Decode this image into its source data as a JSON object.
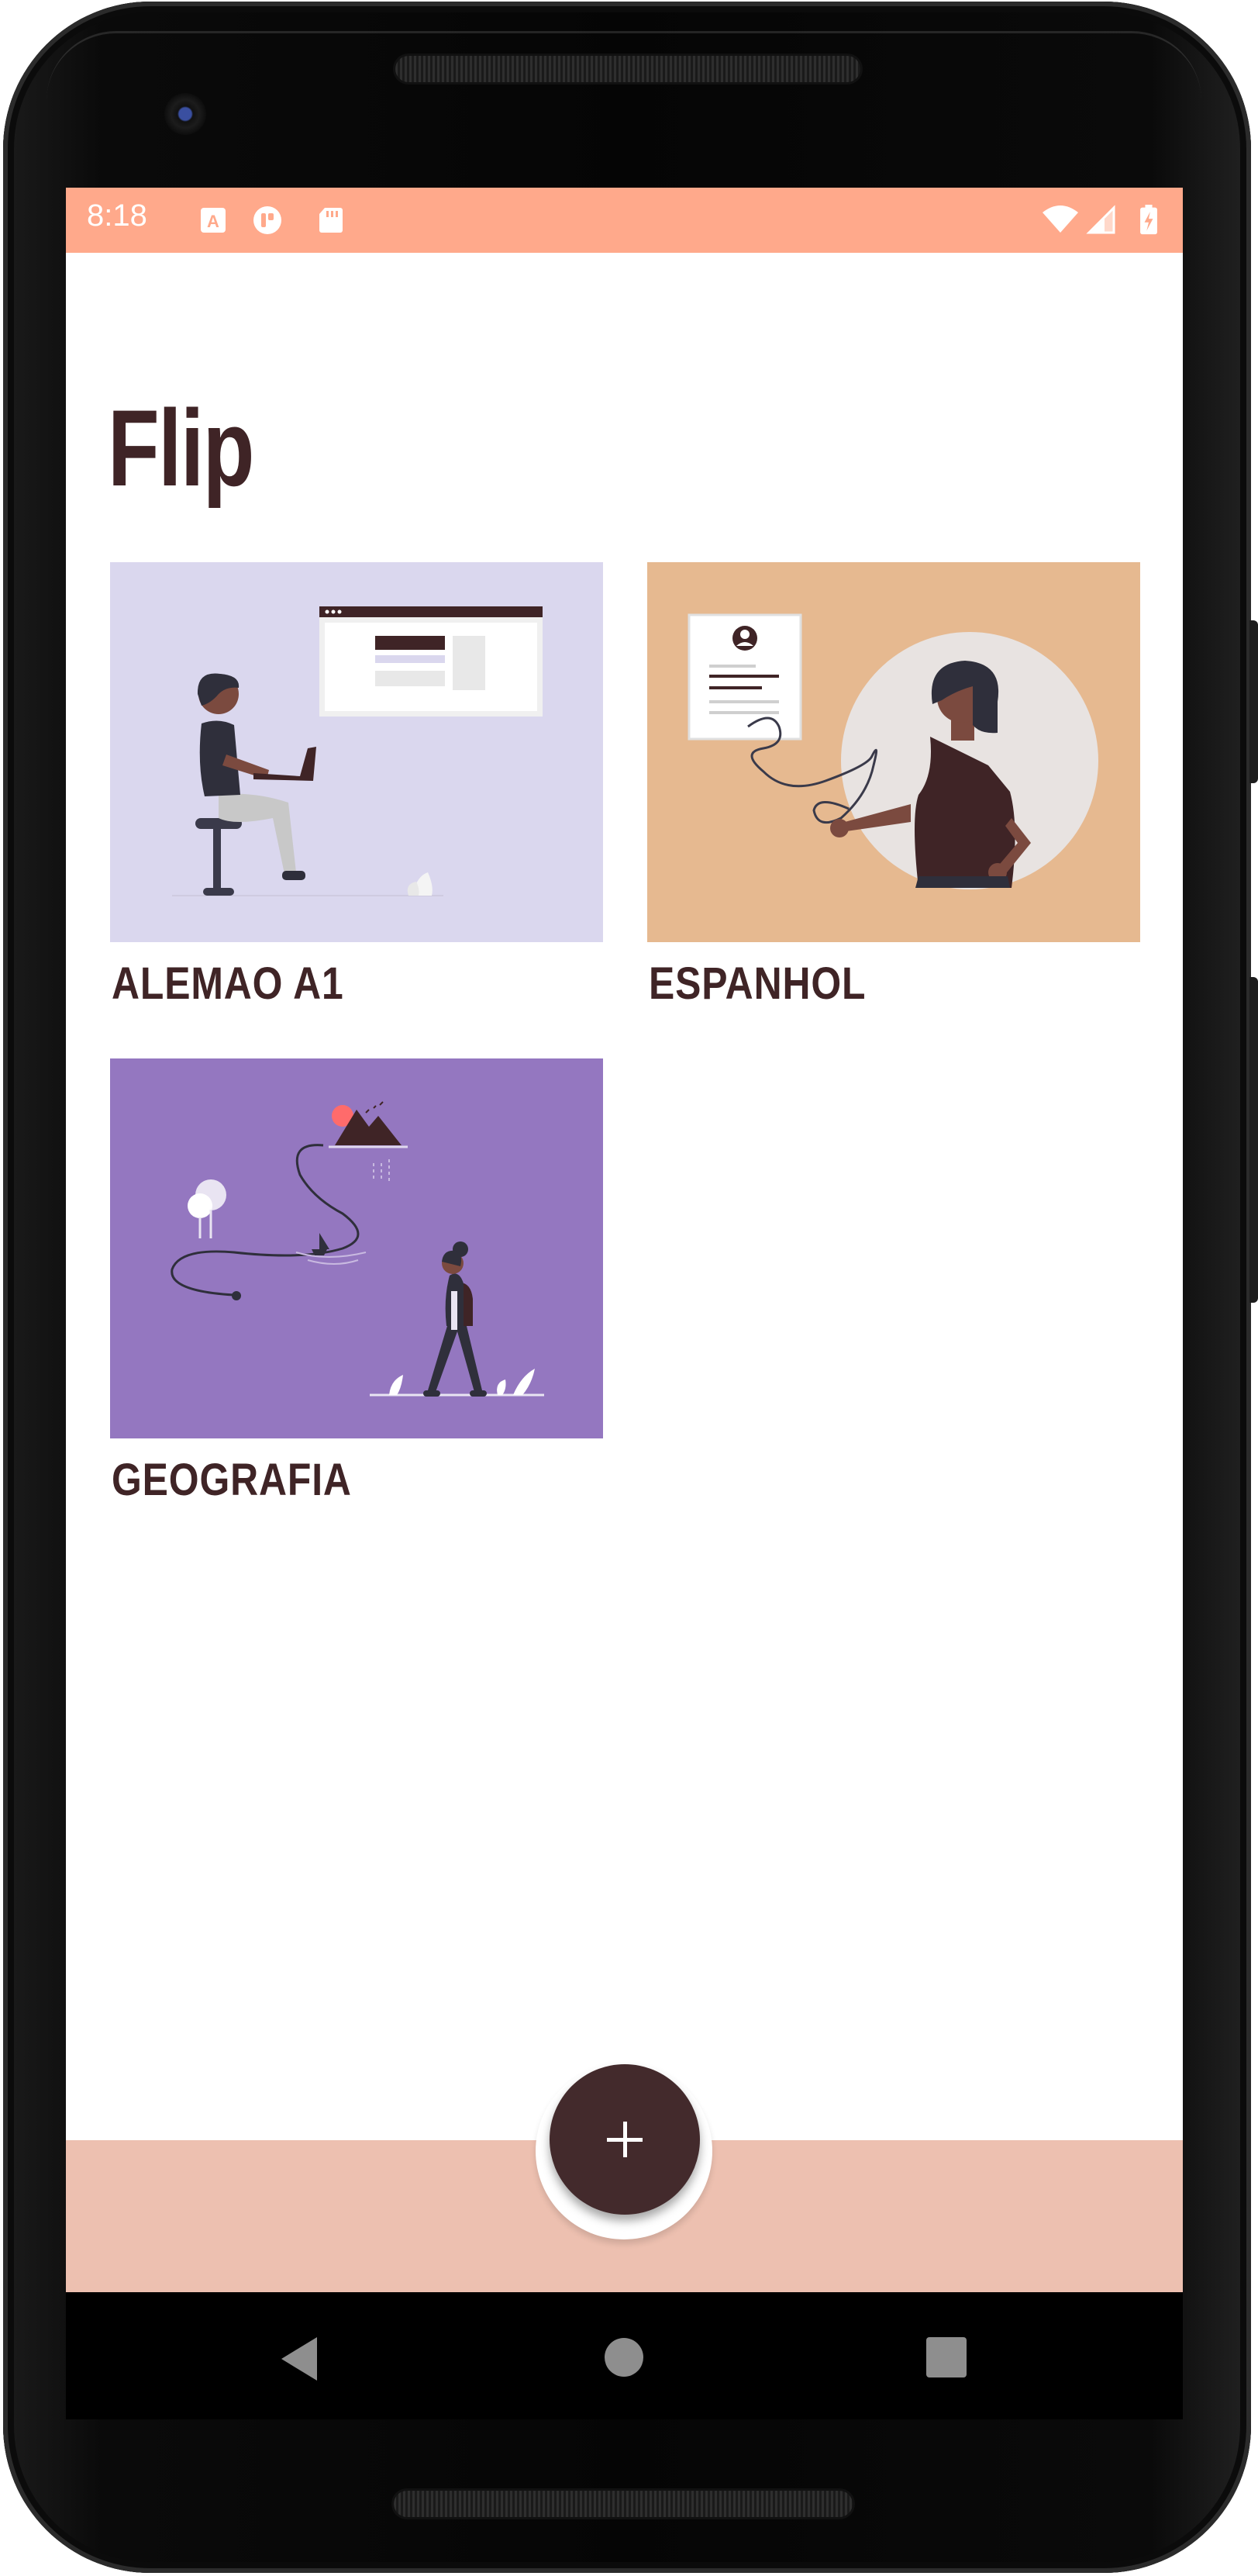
{
  "status_bar": {
    "time": "8:18",
    "background": "#ffa98b",
    "icons": [
      "translate-icon",
      "app-circle-icon",
      "sd-card-icon",
      "wifi-icon",
      "signal-icon",
      "battery-charging-icon"
    ]
  },
  "app": {
    "title": "Flip",
    "text_color": "#3f2426"
  },
  "decks": [
    {
      "label": "Alemao A1",
      "image": "person-laptop-illustration",
      "background": "#dad7ee"
    },
    {
      "label": "Espanhol",
      "image": "person-profile-card-illustration",
      "background": "#e6b990"
    },
    {
      "label": "Geografia",
      "image": "traveler-map-illustration",
      "background": "#9477c0"
    }
  ],
  "bottom_bar": {
    "background": "#edc0b0",
    "fab_icon": "plus-icon",
    "fab_color": "#432a2c"
  },
  "nav_bar": {
    "buttons": [
      "back-icon",
      "home-icon",
      "recents-icon"
    ]
  }
}
